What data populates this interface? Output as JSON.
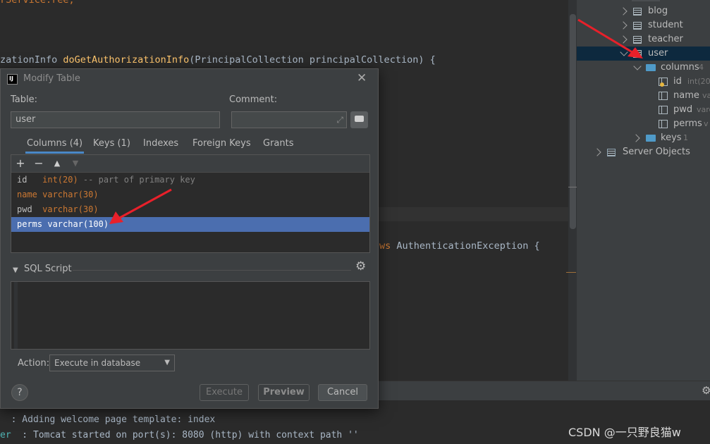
{
  "editor": {
    "line_top": "rService.ree,",
    "line_auth": {
      "pre": "zationInfo ",
      "fn": "doGetAuthorizationInfo",
      "args": "(PrincipalCollection principalCollection) {"
    },
    "line_exc": {
      "kw": "ws",
      "rest": " AuthenticationException {"
    }
  },
  "tree": {
    "tables": [
      "blog",
      "student",
      "teacher",
      "user"
    ],
    "columns_label": "columns",
    "columns_count": "4",
    "columns": [
      {
        "name": "id",
        "type": "int(20"
      },
      {
        "name": "name",
        "type": "va"
      },
      {
        "name": "pwd",
        "type": "varc"
      },
      {
        "name": "perms",
        "type": "v"
      }
    ],
    "keys_label": "keys",
    "keys_count": "1",
    "server_objects": "Server Objects"
  },
  "dialog": {
    "title": "Modify Table",
    "table_label": "Table:",
    "table_value": "user",
    "comment_label": "Comment:",
    "tabs": [
      "Columns (4)",
      "Keys (1)",
      "Indexes",
      "Foreign Keys",
      "Grants"
    ],
    "columns": [
      {
        "name": "id   ",
        "type": "int(20)",
        "comment": " -- part of primary key"
      },
      {
        "name": "name ",
        "type": "varchar(30)",
        "comment": ""
      },
      {
        "name": "pwd  ",
        "type": "varchar(30)",
        "comment": ""
      },
      {
        "name": "perms",
        "type": " varchar(100)",
        "comment": ""
      }
    ],
    "sql_label": "SQL Script",
    "action_label": "Action:",
    "action_value": "Execute in database",
    "execute": "Execute",
    "preview": "Preview",
    "cancel": "Cancel",
    "help": "?"
  },
  "console": {
    "line1": "  : Adding welcome page template: index",
    "line2_prefix": "er",
    "line2": "  : Tomcat started on port(s): 8080 (http) with context path ''"
  },
  "watermark": "CSDN @一只野良猫w",
  "colors": {
    "selection": "#4b6eaf",
    "arrow": "#e8202a"
  }
}
